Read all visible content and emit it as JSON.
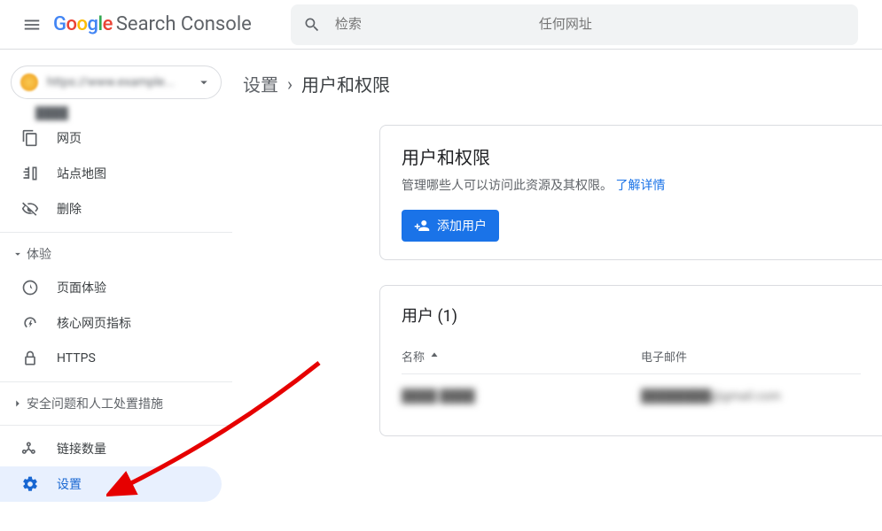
{
  "header": {
    "logo_text": "Google",
    "product_name": "Search Console",
    "search_placeholder": "检索                                                任何网址"
  },
  "property": {
    "label": "https://www.example..."
  },
  "sidebar": {
    "truncated_top": "...",
    "items_index": [
      {
        "icon": "pages",
        "label": "网页"
      },
      {
        "icon": "sitemap",
        "label": "站点地图"
      },
      {
        "icon": "removal",
        "label": "删除"
      }
    ],
    "group_experience": "体验",
    "items_experience": [
      {
        "icon": "pageexp",
        "label": "页面体验"
      },
      {
        "icon": "cwv",
        "label": "核心网页指标"
      },
      {
        "icon": "https",
        "label": "HTTPS"
      }
    ],
    "group_security": "安全问题和人工处置措施",
    "items_bottom": [
      {
        "icon": "links",
        "label": "链接数量"
      },
      {
        "icon": "settings",
        "label": "设置",
        "active": true
      }
    ]
  },
  "breadcrumb": {
    "root": "设置",
    "current": "用户和权限"
  },
  "card_perms": {
    "title": "用户和权限",
    "subtitle_prefix": "管理哪些人可以访问此资源及其权限。",
    "learn_more": "了解详情",
    "add_user": "添加用户"
  },
  "card_users": {
    "title": "用户 (1)",
    "col_name": "名称",
    "col_email": "电子邮件",
    "rows": [
      {
        "name": "████ ████",
        "email": "████████@gmail.com"
      }
    ]
  }
}
